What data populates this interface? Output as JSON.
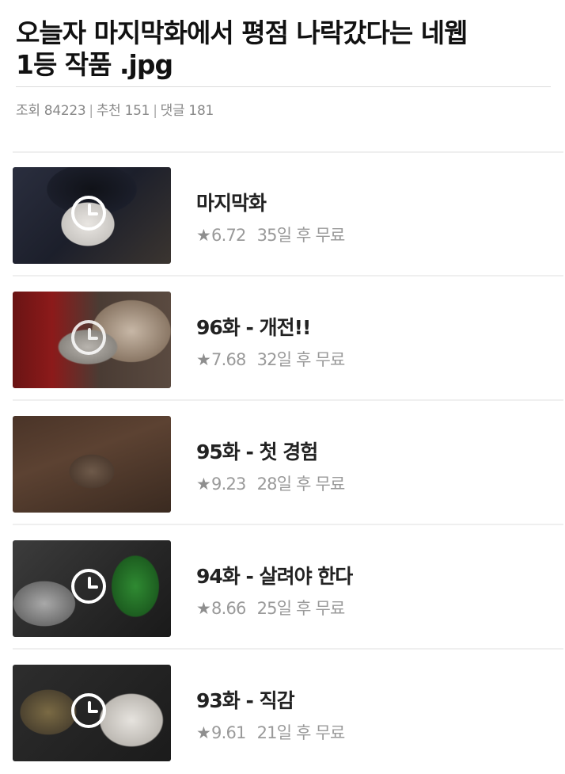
{
  "post": {
    "title_line1": "오늘자 마지막화에서 평점 나락갔다는 네웹",
    "title_line2": "1등 작품 .jpg",
    "views_label": "조회",
    "views": "84223",
    "recommend_label": "추천",
    "recommend": "151",
    "comments_label": "댓글",
    "comments": "181",
    "separator": "|"
  },
  "episodes": [
    {
      "title": "마지막화",
      "star": "★",
      "rating": "6.72",
      "free_text": "35일 후 무료",
      "thumb_icon": "clock-icon"
    },
    {
      "title": "96화 - 개전!!",
      "star": "★",
      "rating": "7.68",
      "free_text": "32일 후 무료",
      "thumb_icon": "clock-icon"
    },
    {
      "title": "95화 - 첫 경험",
      "star": "★",
      "rating": "9.23",
      "free_text": "28일 후 무료",
      "thumb_icon": "none"
    },
    {
      "title": "94화 - 살려야 한다",
      "star": "★",
      "rating": "8.66",
      "free_text": "25일 후 무료",
      "thumb_icon": "clock-icon"
    },
    {
      "title": "93화 - 직감",
      "star": "★",
      "rating": "9.61",
      "free_text": "21일 후 무료",
      "thumb_icon": "clock-icon"
    }
  ],
  "colors": {
    "title_text": "#111111",
    "meta_text": "#888888",
    "info_text": "#9a9a9a",
    "divider": "#efefef"
  }
}
